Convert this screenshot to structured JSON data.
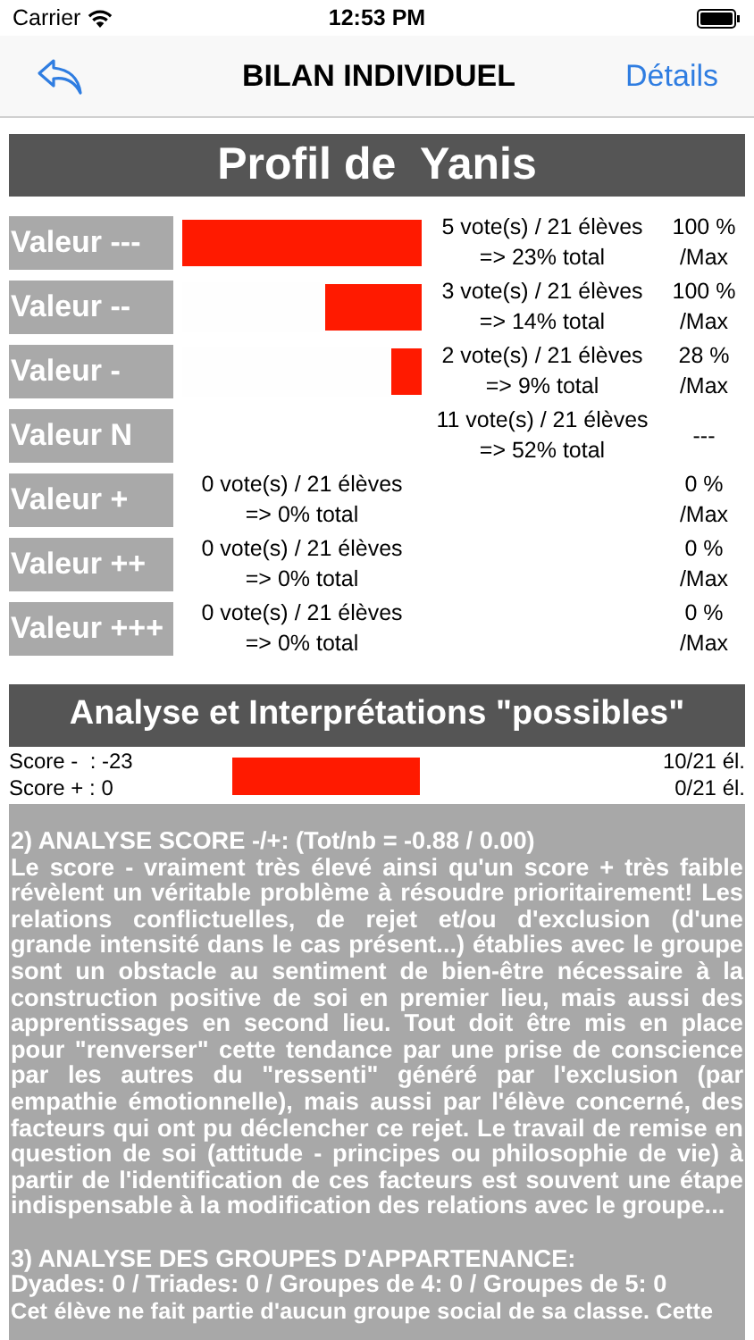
{
  "status_bar": {
    "carrier": "Carrier",
    "time": "12:53 PM"
  },
  "nav": {
    "title": "BILAN INDIVIDUEL",
    "action": "Détails"
  },
  "profile": {
    "title": "Profil de  Yanis",
    "rows": [
      {
        "kind": "negative",
        "label": "Valeur ---",
        "level": 1,
        "votes": "5 vote(s) / 21 élèves",
        "total": "=> 23% total",
        "percent": "100 %",
        "per_max": "/Max"
      },
      {
        "kind": "negative",
        "label": "Valeur --",
        "level": 0.4,
        "votes": "3 vote(s) / 21 élèves",
        "total": "=> 14% total",
        "percent": "100 %",
        "per_max": "/Max"
      },
      {
        "kind": "negative",
        "label": "Valeur -",
        "level": 0.13,
        "votes": "2 vote(s) / 21 élèves",
        "total": "=> 9% total",
        "percent": "28 %",
        "per_max": "/Max"
      },
      {
        "kind": "neutral",
        "label": "Valeur N",
        "votes": "11 vote(s) / 21 élèves",
        "total": "=> 52% total",
        "percent": "---"
      },
      {
        "kind": "positive",
        "label": "Valeur +",
        "votes": "0 vote(s) / 21 élèves",
        "total": "=> 0% total",
        "percent": "0 %",
        "per_max": "/Max"
      },
      {
        "kind": "positive",
        "label": "Valeur ++",
        "votes": "0 vote(s) / 21 élèves",
        "total": "=> 0% total",
        "percent": "0 %",
        "per_max": "/Max"
      },
      {
        "kind": "positive",
        "label": "Valeur +++",
        "votes": "0 vote(s) / 21 élèves",
        "total": "=> 0% total",
        "percent": "0 %",
        "per_max": "/Max"
      }
    ]
  },
  "analysis": {
    "title": "Analyse et Interprétations \"possibles\"",
    "score_minus": "Score -  : -23",
    "score_plus": "Score + : 0",
    "count_minus": "10/21 él.",
    "count_plus": "0/21 él.",
    "paragraphs": [
      {
        "heading": "2) ANALYSE SCORE -/+: (Tot/nb = -0.88 / 0.00)",
        "body": "Le score - vraiment très élevé ainsi qu'un score + très faible révèlent un véritable problème à résoudre prioritairement! Les relations conflictuelles, de rejet et/ou d'exclusion (d'une grande intensité dans le cas présent...) établies avec le groupe sont un obstacle au sentiment de bien-être nécessaire à la construction positive de soi en premier lieu, mais aussi des apprentissages en second lieu. Tout doit être mis en place pour \"renverser\" cette tendance par une prise de conscience par les autres du \"ressenti\" généré par l'exclusion (par empathie émotionnelle), mais aussi par l'élève concerné, des facteurs qui ont pu déclencher ce rejet. Le travail de remise en question de soi (attitude - principes ou philosophie de vie) à partir de l'identification de ces facteurs est souvent une étape indispensable à la modification des relations avec le groupe..."
      },
      {
        "heading": "3) ANALYSE DES GROUPES D'APPARTENANCE:",
        "body": "Dyades: 0 / Triades: 0 / Groupes de 4: 0 / Groupes de 5: 0",
        "last_line": "Cet élève ne fait partie d'aucun groupe social de sa classe. Cette"
      }
    ]
  }
}
